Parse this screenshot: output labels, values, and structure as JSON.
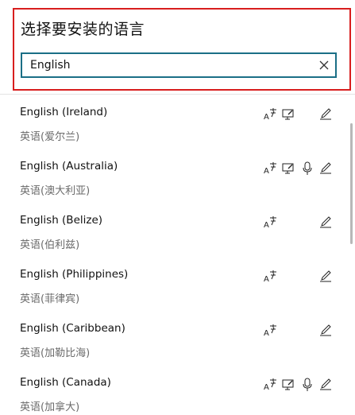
{
  "dialog": {
    "title": "选择要安装的语言"
  },
  "search": {
    "value": "English",
    "placeholder": ""
  },
  "languages": [
    {
      "name": "English (Ireland)",
      "native": "英语(爱尔兰)",
      "features": [
        "text-to-speech",
        "handwriting-display",
        "handwriting-pen"
      ]
    },
    {
      "name": "English (Australia)",
      "native": "英语(澳大利亚)",
      "features": [
        "text-to-speech",
        "handwriting-display",
        "speech-recognition",
        "handwriting-pen"
      ]
    },
    {
      "name": "English (Belize)",
      "native": "英语(伯利兹)",
      "features": [
        "text-to-speech",
        "handwriting-pen"
      ]
    },
    {
      "name": "English (Philippines)",
      "native": "英语(菲律宾)",
      "features": [
        "text-to-speech",
        "handwriting-pen"
      ]
    },
    {
      "name": "English (Caribbean)",
      "native": "英语(加勒比海)",
      "features": [
        "text-to-speech",
        "handwriting-pen"
      ]
    },
    {
      "name": "English (Canada)",
      "native": "英语(加拿大)",
      "features": [
        "text-to-speech",
        "handwriting-display",
        "speech-recognition",
        "handwriting-pen"
      ]
    }
  ],
  "colors": {
    "highlight_border": "#d81e1e",
    "search_border": "#1b6f86"
  }
}
